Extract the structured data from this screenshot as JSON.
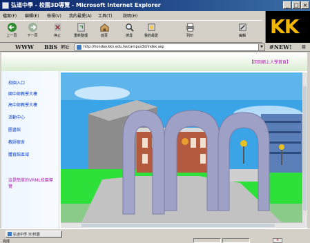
{
  "window": {
    "title": "弘道中學 - 校園3D導覽 - Microsoft Internet Explorer",
    "controls": {
      "minimize": "_",
      "maximize": "□",
      "close": "×"
    }
  },
  "menu": {
    "items": [
      "檔案(F)",
      "編輯(E)",
      "檢視(V)",
      "我的最愛(A)",
      "工具(T)",
      "說明(H)"
    ]
  },
  "toolbar": {
    "buttons": [
      {
        "label": "上一頁",
        "icon": "back-arrow-icon"
      },
      {
        "label": "下一頁",
        "icon": "forward-arrow-icon"
      },
      {
        "label": "停止",
        "icon": "stop-icon"
      },
      {
        "label": "重新整理",
        "icon": "refresh-icon"
      },
      {
        "label": "首頁",
        "icon": "home-icon"
      },
      {
        "label": "搜尋",
        "icon": "search-icon"
      },
      {
        "label": "我的最愛",
        "icon": "favorites-icon"
      },
      {
        "label": "列印",
        "icon": "print-icon"
      },
      {
        "label": "編輯",
        "icon": "edit-icon"
      }
    ]
  },
  "logo": {
    "text": "KK"
  },
  "links": {
    "www": "WWW",
    "bbs": "BBS",
    "address_label": "網址",
    "url": "http://hondao.kkn.edu.tw/campus3d/index.asp",
    "new_label": "#NEW!",
    "close": "⊠"
  },
  "page": {
    "banner_link": "【回到網上人學首頁】",
    "nav": [
      "校園入口",
      "國中部教學大樓",
      "高中部教學大樓",
      "活動中心",
      "圖書館",
      "教師宿舍",
      "體育館區域"
    ],
    "note": "這是簡單的VRML校園導覽"
  },
  "scene": {
    "sky_color": "#3aa4e6",
    "grass_color": "#2ee03a",
    "arch_color": "#9ea0c6",
    "building_color": "#b45a3e"
  },
  "taskbar": {
    "tab_title": "弘道中學 3D校園",
    "status": "完成",
    "zone_label": "網際網路"
  }
}
